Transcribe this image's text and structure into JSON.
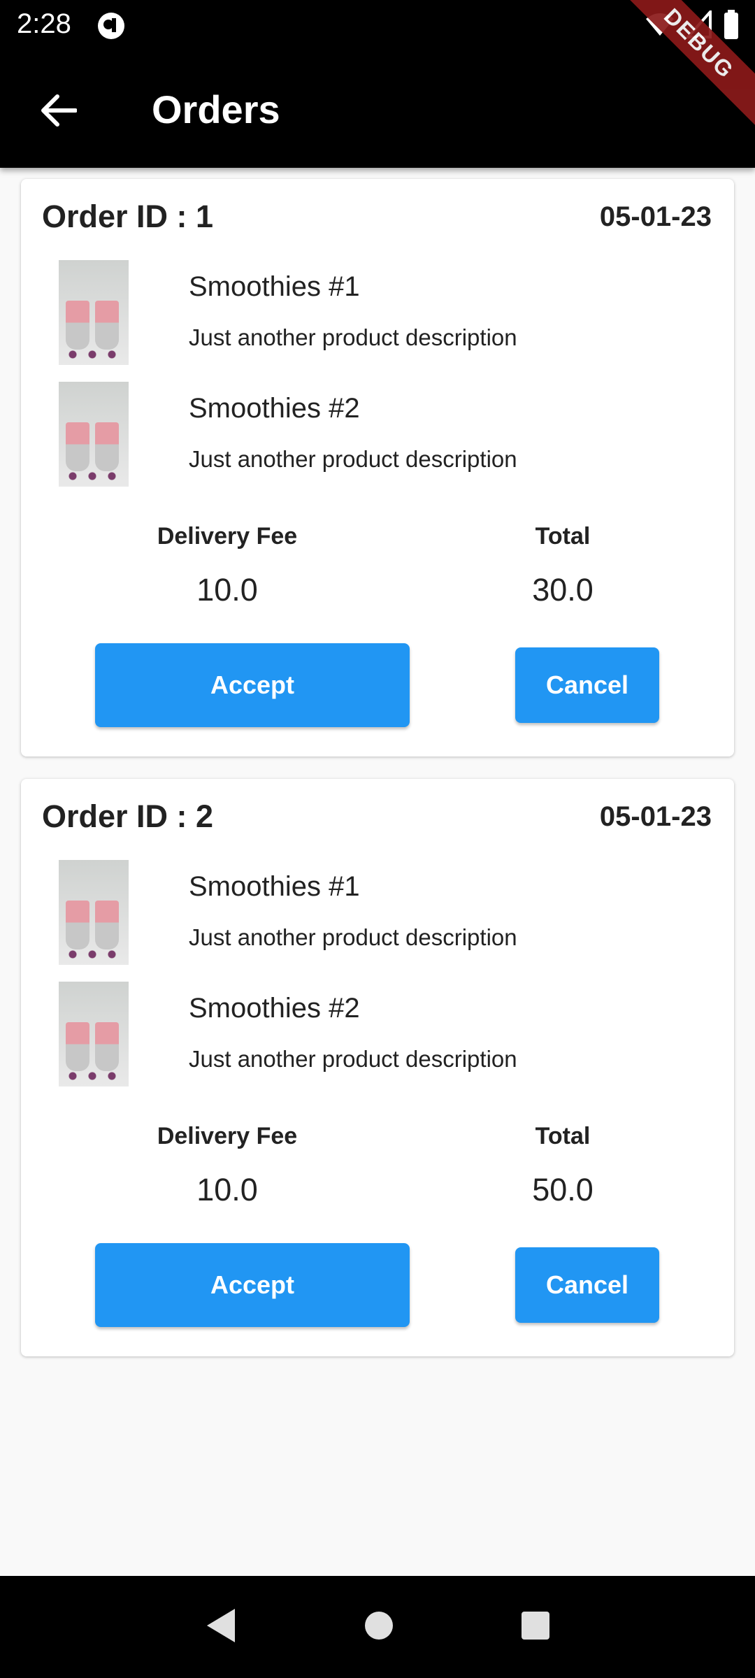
{
  "status_bar": {
    "time": "2:28"
  },
  "app_bar": {
    "title": "Orders",
    "debug_label": "DEBUG"
  },
  "orders": [
    {
      "order_id_label": "Order ID : 1",
      "date": "05-01-23",
      "items": [
        {
          "name": "Smoothies #1",
          "description": "Just another product description"
        },
        {
          "name": "Smoothies #2",
          "description": "Just another product description"
        }
      ],
      "delivery_fee_label": "Delivery Fee",
      "delivery_fee": "10.0",
      "total_label": "Total",
      "total": "30.0",
      "accept_label": "Accept",
      "cancel_label": "Cancel"
    },
    {
      "order_id_label": "Order ID : 2",
      "date": "05-01-23",
      "items": [
        {
          "name": "Smoothies #1",
          "description": "Just another product description"
        },
        {
          "name": "Smoothies #2",
          "description": "Just another product description"
        }
      ],
      "delivery_fee_label": "Delivery Fee",
      "delivery_fee": "10.0",
      "total_label": "Total",
      "total": "50.0",
      "accept_label": "Accept",
      "cancel_label": "Cancel"
    }
  ],
  "colors": {
    "primary": "#2196f3",
    "app_bar": "#000000",
    "background": "#f9f9f9",
    "debug_banner": "#8b1a1a"
  },
  "icons": [
    "back-arrow-icon",
    "wifi-icon",
    "signal-icon",
    "battery-icon",
    "nav-back-icon",
    "nav-home-icon",
    "nav-recents-icon"
  ]
}
